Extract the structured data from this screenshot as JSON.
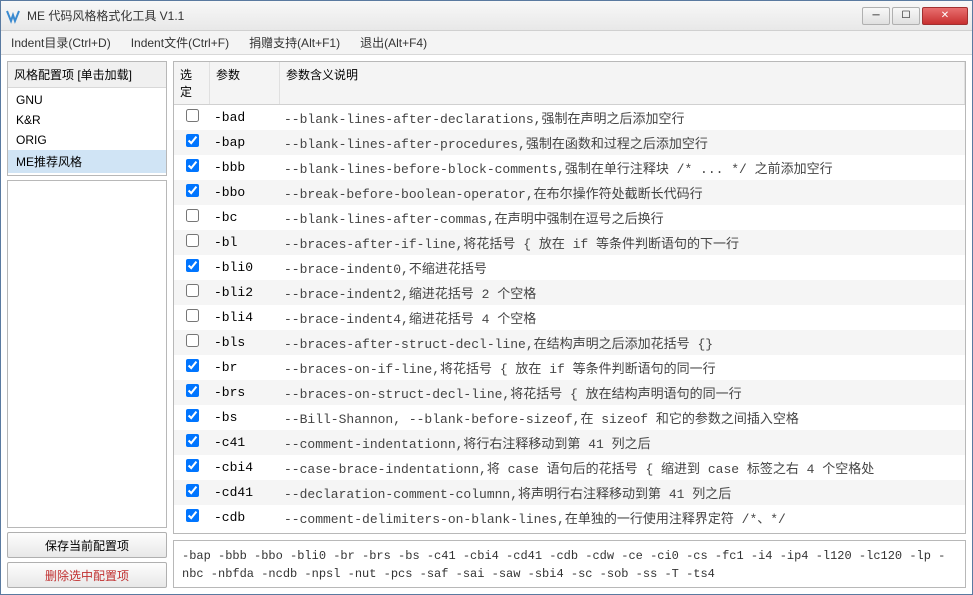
{
  "window": {
    "title": "ME 代码风格格式化工具 V1.1"
  },
  "menubar": [
    "Indent目录(Ctrl+D)",
    "Indent文件(Ctrl+F)",
    "捐赠支持(Alt+F1)",
    "退出(Alt+F4)"
  ],
  "presets": {
    "title": "风格配置项 [单击加载]",
    "items": [
      "GNU",
      "K&R",
      "ORIG",
      "ME推荐风格"
    ],
    "selected": 3
  },
  "buttons": {
    "save": "保存当前配置项",
    "delete": "删除选中配置项"
  },
  "grid": {
    "headers": {
      "sel": "选定",
      "param": "参数",
      "desc": "参数含义说明"
    },
    "rows": [
      {
        "checked": false,
        "param": "-bad",
        "desc": "--blank-lines-after-declarations,强制在声明之后添加空行"
      },
      {
        "checked": true,
        "param": "-bap",
        "desc": "--blank-lines-after-procedures,强制在函数和过程之后添加空行"
      },
      {
        "checked": true,
        "param": "-bbb",
        "desc": "--blank-lines-before-block-comments,强制在单行注释块 /* ... */ 之前添加空行"
      },
      {
        "checked": true,
        "param": "-bbo",
        "desc": "--break-before-boolean-operator,在布尔操作符处截断长代码行"
      },
      {
        "checked": false,
        "param": "-bc",
        "desc": "--blank-lines-after-commas,在声明中强制在逗号之后换行"
      },
      {
        "checked": false,
        "param": "-bl",
        "desc": "--braces-after-if-line,将花括号 { 放在 if 等条件判断语句的下一行"
      },
      {
        "checked": true,
        "param": "-bli0",
        "desc": "--brace-indent0,不缩进花括号"
      },
      {
        "checked": false,
        "param": "-bli2",
        "desc": "--brace-indent2,缩进花括号 2 个空格"
      },
      {
        "checked": false,
        "param": "-bli4",
        "desc": "--brace-indent4,缩进花括号 4 个空格"
      },
      {
        "checked": false,
        "param": "-bls",
        "desc": "--braces-after-struct-decl-line,在结构声明之后添加花括号 {}"
      },
      {
        "checked": true,
        "param": "-br",
        "desc": "--braces-on-if-line,将花括号 { 放在 if 等条件判断语句的同一行"
      },
      {
        "checked": true,
        "param": "-brs",
        "desc": "--braces-on-struct-decl-line,将花括号 { 放在结构声明语句的同一行"
      },
      {
        "checked": true,
        "param": "-bs",
        "desc": "--Bill-Shannon, --blank-before-sizeof,在 sizeof 和它的参数之间插入空格"
      },
      {
        "checked": true,
        "param": "-c41",
        "desc": "--comment-indentationn,将行右注释移动到第 41 列之后"
      },
      {
        "checked": true,
        "param": "-cbi4",
        "desc": "--case-brace-indentationn,将 case 语句后的花括号 { 缩进到 case 标签之右 4 个空格处"
      },
      {
        "checked": true,
        "param": "-cd41",
        "desc": "--declaration-comment-columnn,将声明行右注释移动到第 41 列之后"
      },
      {
        "checked": true,
        "param": "-cdb",
        "desc": "--comment-delimiters-on-blank-lines,在单独的一行使用注释界定符 /*、*/"
      }
    ]
  },
  "summary": "-bap -bbb -bbo -bli0 -br -brs -bs -c41 -cbi4 -cd41 -cdb -cdw -ce -ci0 -cs -fc1 -i4 -ip4 -l120 -lc120 -lp -nbc -nbfda -ncdb -npsl -nut -pcs -saf -sai -saw -sbi4 -sc -sob -ss -T -ts4"
}
